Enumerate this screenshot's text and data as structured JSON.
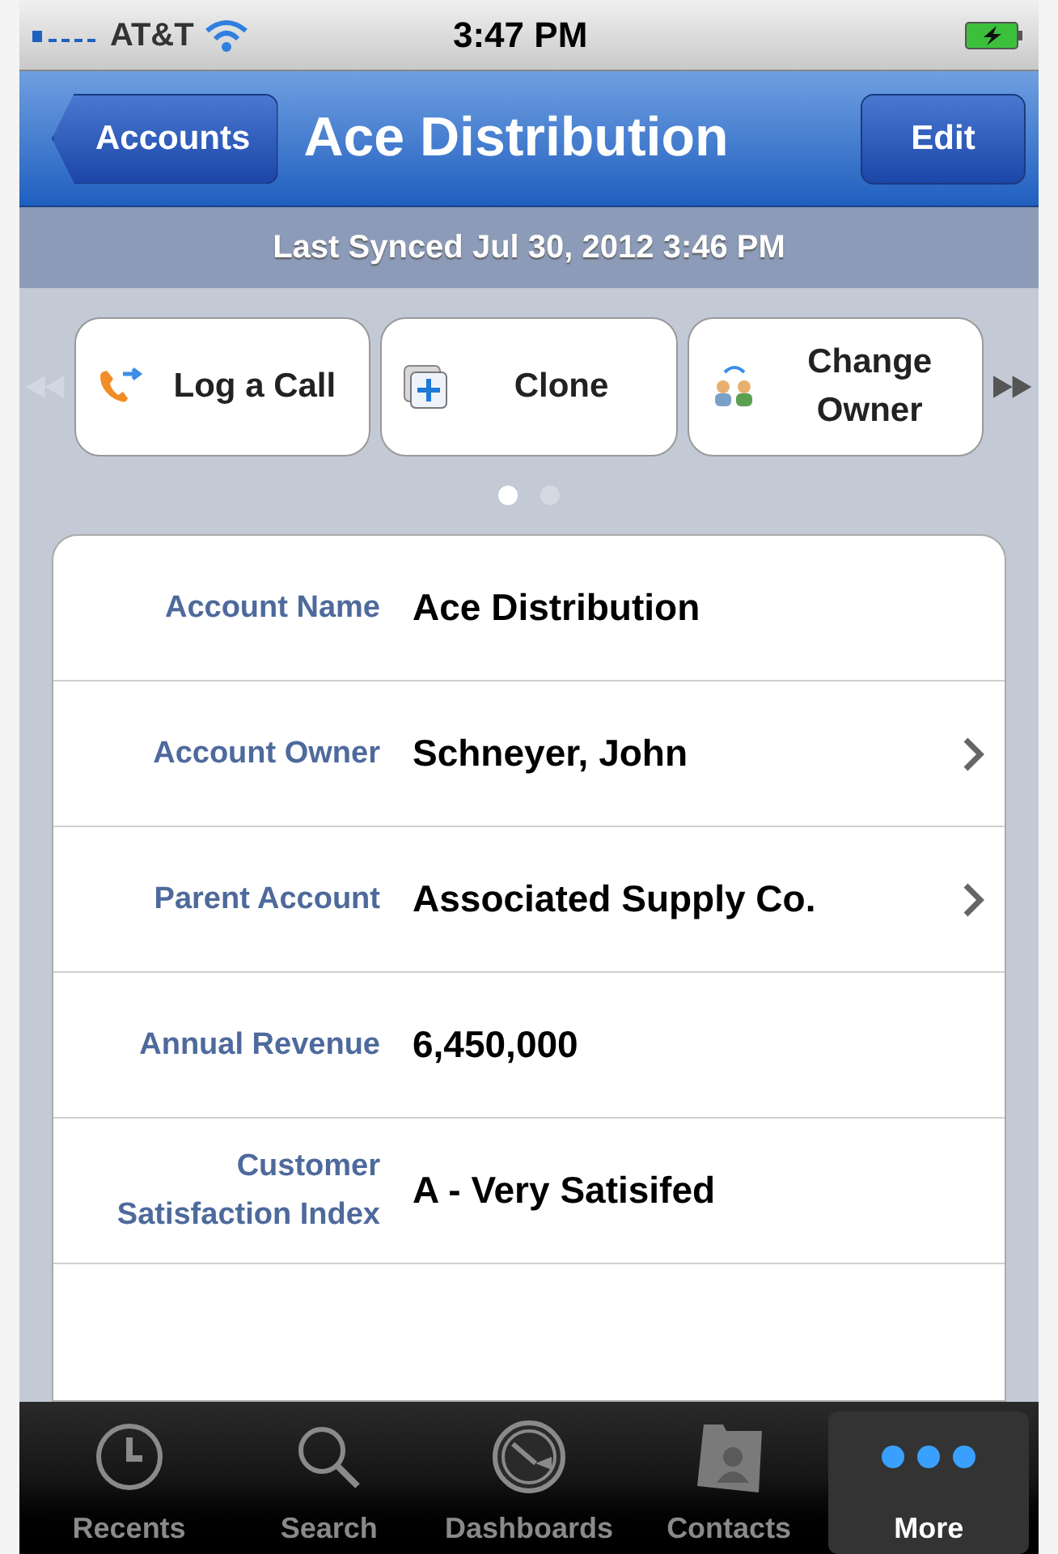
{
  "status_bar": {
    "carrier": "AT&T",
    "time": "3:47 PM"
  },
  "nav": {
    "back": "Accounts",
    "title": "Ace Distribution",
    "action": "Edit"
  },
  "sync_banner": "Last Synced Jul 30, 2012 3:46 PM",
  "actions": [
    {
      "kind": "call",
      "label": "Log a Call"
    },
    {
      "kind": "clone",
      "label": "Clone"
    },
    {
      "kind": "owner",
      "label": "Change Owner"
    }
  ],
  "pages": [
    {
      "selected": true
    },
    {
      "selected": false
    }
  ],
  "fields": [
    {
      "label": "Account Name",
      "value": "Ace Distribution",
      "link": false
    },
    {
      "label": "Account Owner",
      "value": "Schneyer, John",
      "link": true
    },
    {
      "label": "Parent Account",
      "value": "Associated Supply Co.",
      "link": true
    },
    {
      "label": "Annual Revenue",
      "value": "6,450,000",
      "link": false
    },
    {
      "label": "Customer Satisfaction Index",
      "value": "A - Very Satisifed",
      "link": false
    }
  ],
  "tabs": [
    {
      "kind": "clock",
      "label": "Recents",
      "selected": false
    },
    {
      "kind": "search",
      "label": "Search",
      "selected": false
    },
    {
      "kind": "gauge",
      "label": "Dashboards",
      "selected": false
    },
    {
      "kind": "folder",
      "label": "Contacts",
      "selected": false
    },
    {
      "kind": "dots",
      "label": "More",
      "selected": true
    }
  ]
}
